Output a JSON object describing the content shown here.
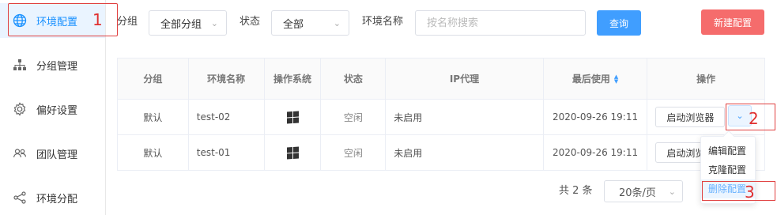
{
  "sidebar": {
    "items": [
      {
        "label": "环境配置",
        "icon": "globe-icon",
        "active": true
      },
      {
        "label": "分组管理",
        "icon": "org-tree-icon"
      },
      {
        "label": "偏好设置",
        "icon": "gear-icon"
      },
      {
        "label": "团队管理",
        "icon": "team-icon"
      },
      {
        "label": "环境分配",
        "icon": "share-icon"
      }
    ]
  },
  "annotations": {
    "a1": "1",
    "a2": "2",
    "a3": "3"
  },
  "filters": {
    "group_label": "分组",
    "group_value": "全部分组",
    "status_label": "状态",
    "status_value": "全部",
    "name_label": "环境名称",
    "name_placeholder": "按名称搜索",
    "query_button": "查询",
    "new_button": "新建配置"
  },
  "table": {
    "headers": [
      "分组",
      "环境名称",
      "操作系统",
      "状态",
      "IP代理",
      "最后使用",
      "操作"
    ],
    "rows": [
      {
        "group": "默认",
        "name": "test-02",
        "os": "windows-icon",
        "status": "空闲",
        "proxy": "未启用",
        "last_used": "2020-09-26 19:11",
        "action": "启动浏览器"
      },
      {
        "group": "默认",
        "name": "test-01",
        "os": "windows-icon",
        "status": "空闲",
        "proxy": "未启用",
        "last_used": "2020-09-26 19:11",
        "action": "启动浏览器"
      }
    ]
  },
  "dropdown": {
    "items": [
      "编辑配置",
      "克隆配置",
      "删除配置"
    ]
  },
  "pagination": {
    "total": "共 2 条",
    "page_size": "20条/页"
  },
  "colors": {
    "accent": "#409eff",
    "danger": "#f56c6c",
    "annotation": "#e03030"
  }
}
